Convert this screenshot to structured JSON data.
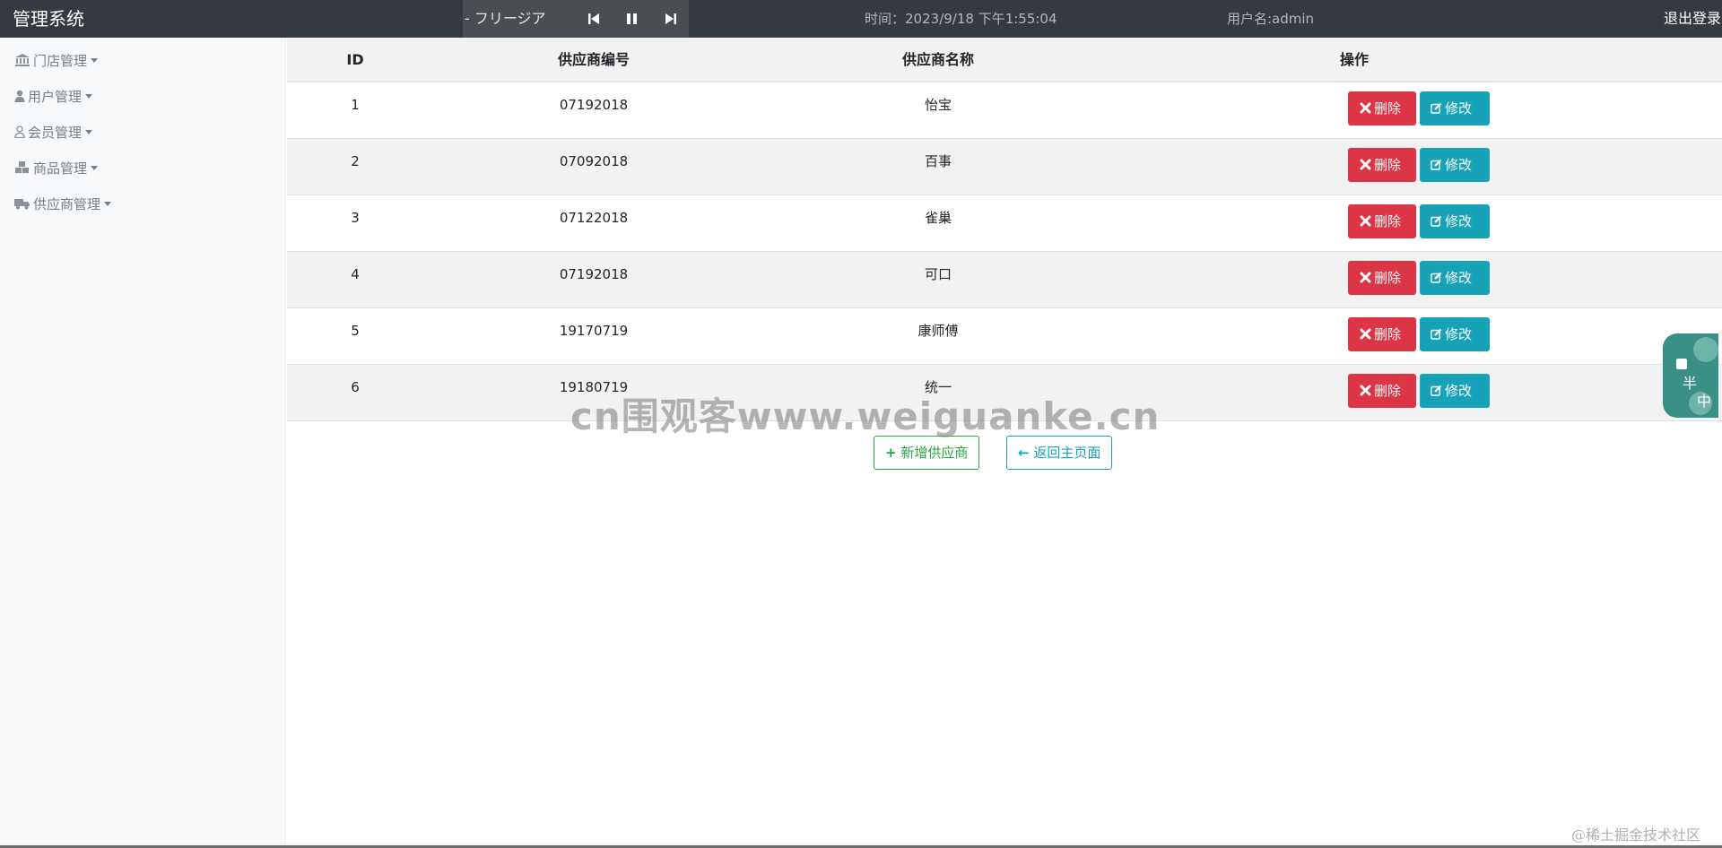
{
  "header": {
    "brand": "管理系统",
    "player": {
      "title": "- フリージア",
      "prev_icon": "skip-back-icon",
      "pause_icon": "pause-icon",
      "next_icon": "skip-forward-icon"
    },
    "time_label": "时间：",
    "time_value": "2023/9/18 下午1:55:04",
    "user_text": "用户名:admin",
    "logout": "退出登录"
  },
  "sidebar": {
    "items": [
      {
        "label": "门店管理",
        "icon": "bank-icon"
      },
      {
        "label": "用户管理",
        "icon": "user-icon"
      },
      {
        "label": "会员管理",
        "icon": "user-outline-icon"
      },
      {
        "label": "商品管理",
        "icon": "cubes-icon"
      },
      {
        "label": "供应商管理",
        "icon": "truck-icon"
      }
    ]
  },
  "table": {
    "headers": [
      "ID",
      "供应商编号",
      "供应商名称",
      "操作"
    ],
    "rows": [
      {
        "id": "1",
        "code": "07192018",
        "name": "怡宝"
      },
      {
        "id": "2",
        "code": "07092018",
        "name": "百事"
      },
      {
        "id": "3",
        "code": "07122018",
        "name": "雀巢"
      },
      {
        "id": "4",
        "code": "07192018",
        "name": "可口"
      },
      {
        "id": "5",
        "code": "19170719",
        "name": "康师傅"
      },
      {
        "id": "6",
        "code": "19180719",
        "name": "统一"
      }
    ],
    "delete_label": "删除",
    "edit_label": "修改"
  },
  "actions": {
    "add_label": "新增供应商",
    "back_label": "返回主页面"
  },
  "watermark": "cn围观客www.weiguanke.cn",
  "widget": {
    "chars": [
      "半",
      "中"
    ]
  },
  "footer_mark": "@稀土掘金技术社区",
  "colors": {
    "topbar": "#343a40",
    "danger": "#dc3545",
    "info": "#17a2b8",
    "success": "#28a745"
  }
}
